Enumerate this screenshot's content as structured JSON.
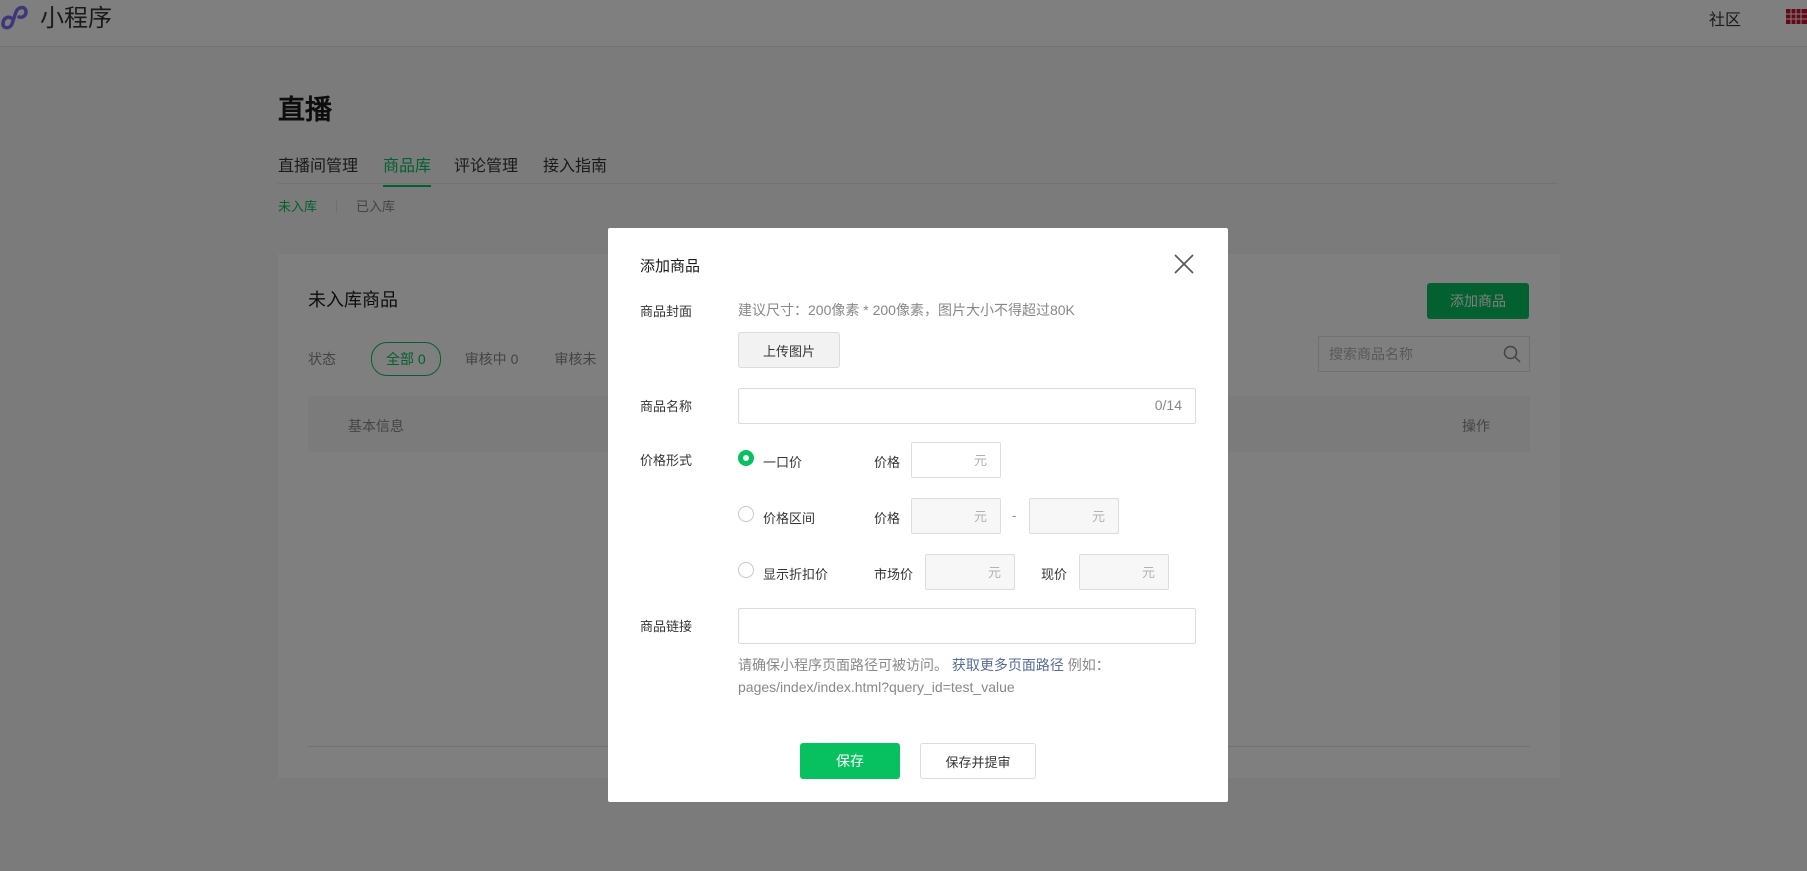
{
  "header": {
    "app_name": "小程序",
    "community": "社区"
  },
  "page": {
    "title": "直播",
    "tabs": [
      {
        "label": "直播间管理"
      },
      {
        "label": "商品库"
      },
      {
        "label": "评论管理"
      },
      {
        "label": "接入指南"
      }
    ],
    "active_tab": "商品库",
    "subtabs": [
      {
        "label": "未入库"
      },
      {
        "label": "已入库"
      }
    ],
    "active_subtab": "未入库"
  },
  "card": {
    "title": "未入库商品",
    "add_button": "添加商品",
    "filter_label": "状态",
    "filters": [
      "全部 0",
      "审核中 0",
      "审核未"
    ],
    "active_filter": "全部 0",
    "search_placeholder": "搜索商品名称",
    "columns": [
      "基本信息",
      "操作"
    ]
  },
  "dialog": {
    "title": "添加商品",
    "cover": {
      "label": "商品封面",
      "hint": "建议尺寸：200像素 * 200像素，图片大小不得超过80K",
      "upload_button": "上传图片"
    },
    "name": {
      "label": "商品名称",
      "value": "",
      "counter": "0/14"
    },
    "price": {
      "label": "价格形式",
      "options": [
        {
          "label": "一口价",
          "selected": true
        },
        {
          "label": "价格区间",
          "selected": false
        },
        {
          "label": "显示折扣价",
          "selected": false
        }
      ],
      "price_label": "价格",
      "unit": "元",
      "range_dash": "-",
      "market_price_label": "市场价",
      "current_price_label": "现价"
    },
    "link": {
      "label": "商品链接",
      "value": "",
      "note_prefix": "请确保小程序页面路径可被访问。",
      "note_link": "获取更多页面路径",
      "note_example": "例如：pages/index/index.html?query_id=test_value"
    },
    "buttons": {
      "save": "保存",
      "save_submit": "保存并提审"
    }
  },
  "colors": {
    "accent": "#07c160",
    "link": "#576b95",
    "mask": "rgba(0,0,0,0.5)"
  }
}
